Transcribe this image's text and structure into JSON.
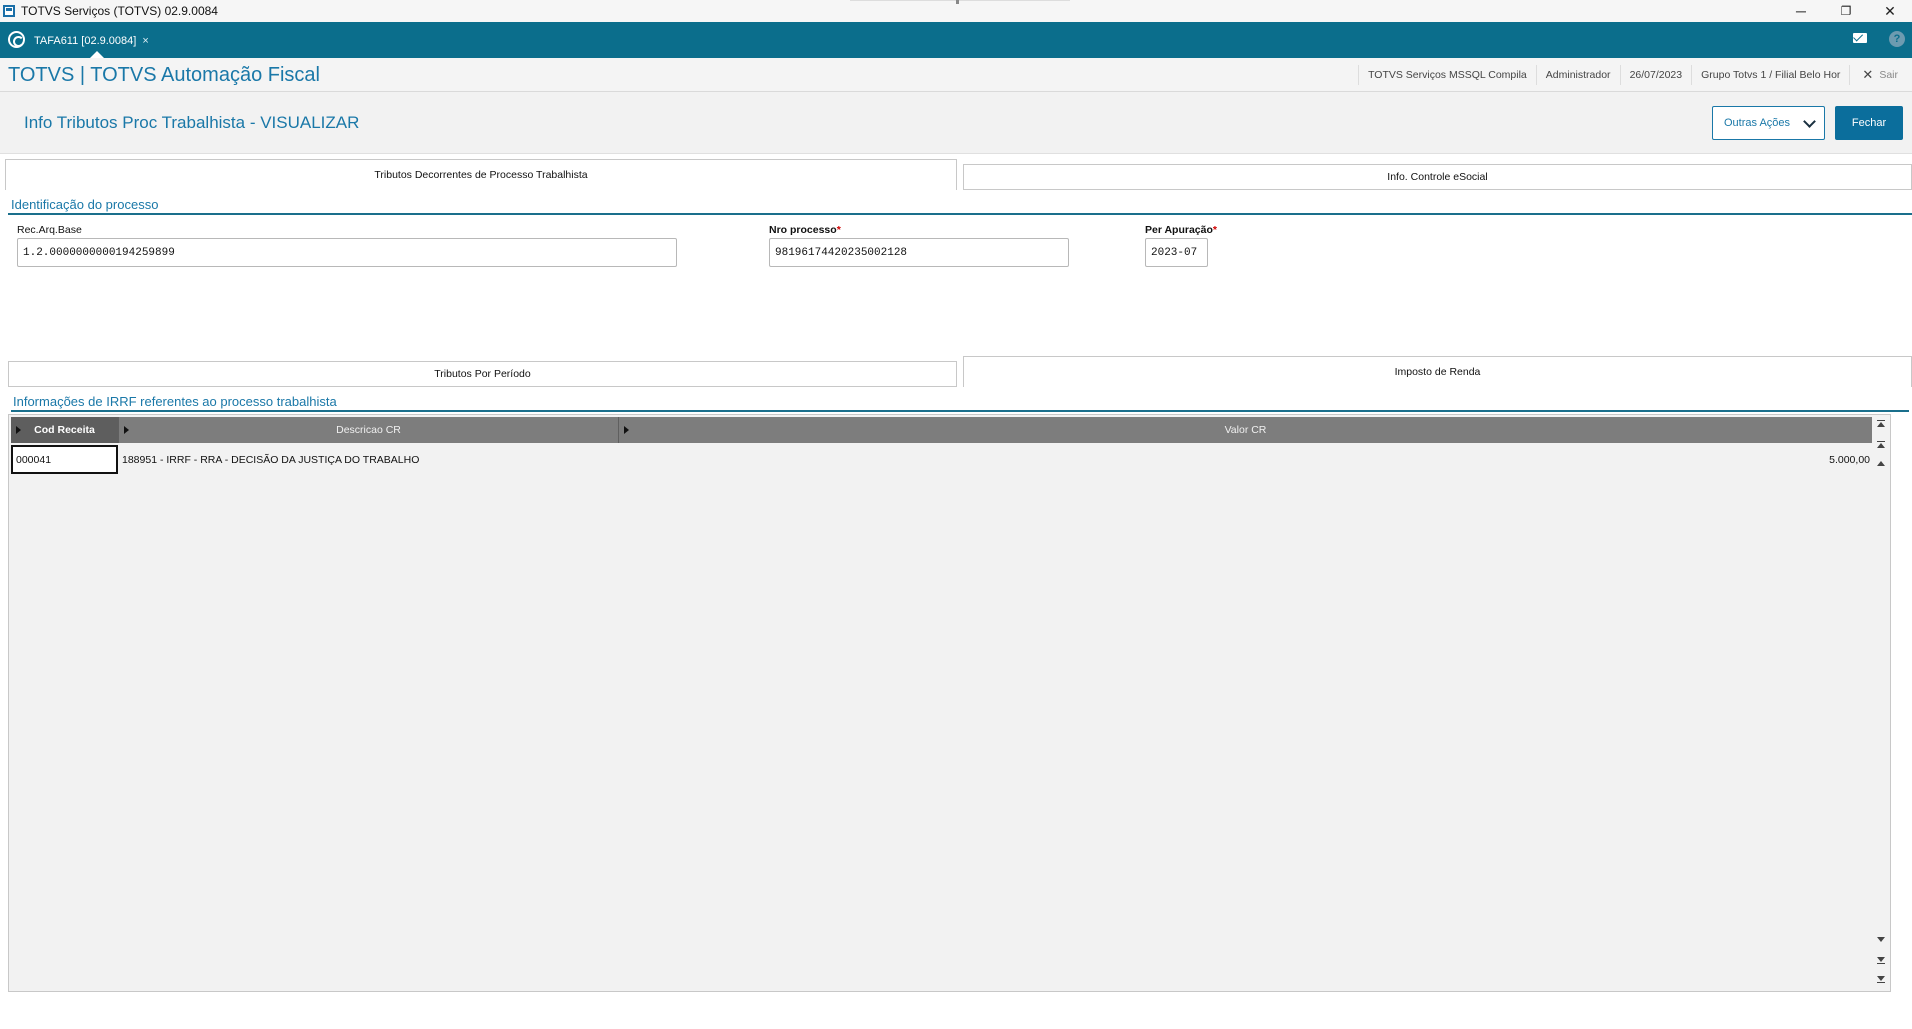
{
  "window": {
    "title": "TOTVS Serviços (TOTVS) 02.9.0084",
    "minimize": "─",
    "restore": "❐",
    "close": "✕"
  },
  "tabstrip": {
    "active_tab": "TAFA611 [02.9.0084]",
    "tab_close": "×",
    "help": "?"
  },
  "app_header": {
    "brand": "TOTVS | TOTVS Automação Fiscal",
    "environment": "TOTVS Serviços MSSQL Compila",
    "user": "Administrador",
    "date": "26/07/2023",
    "branch": "Grupo Totvs 1 / Filial Belo Hor",
    "exit_icon": "✕",
    "exit_label": "Sair"
  },
  "page": {
    "title": "Info Tributos Proc Trabalhista - VISUALIZAR",
    "other_actions": "Outras Ações",
    "close_button": "Fechar"
  },
  "main_tabs": [
    {
      "label": "Tributos Decorrentes de Processo Trabalhista",
      "active": true
    },
    {
      "label": "Info. Controle eSocial",
      "active": false
    }
  ],
  "process_section": {
    "title": "Identificação do processo",
    "fields": [
      {
        "label": "Rec.Arq.Base",
        "required": false,
        "value": "1.2.0000000000194259899"
      },
      {
        "label": "Nro processo",
        "required": true,
        "value": "98196174420235002128"
      },
      {
        "label": "Per Apuração",
        "required": true,
        "value": "2023-07"
      }
    ],
    "required_mark": "*"
  },
  "sub_tabs": [
    {
      "label": "Tributos Por Período",
      "active": false
    },
    {
      "label": "Imposto de Renda",
      "active": true
    }
  ],
  "irrf_section": {
    "title": "Informações de IRRF referentes ao processo trabalhista",
    "columns": [
      "Cod Receita",
      "Descricao CR",
      "Valor CR"
    ],
    "rows": [
      {
        "cod_receita": "000041",
        "descricao": "188951 - IRRF - RRA - DECISÃO DA JUSTIÇA DO TRABALHO",
        "valor": "5.000,00"
      }
    ]
  },
  "colors": {
    "teal_strip": "#0b6e8c",
    "accent_blue": "#1a78a8",
    "fechar_bg": "#0b6e9c",
    "grid_header": "#7d7d7d",
    "required": "#d00000"
  }
}
